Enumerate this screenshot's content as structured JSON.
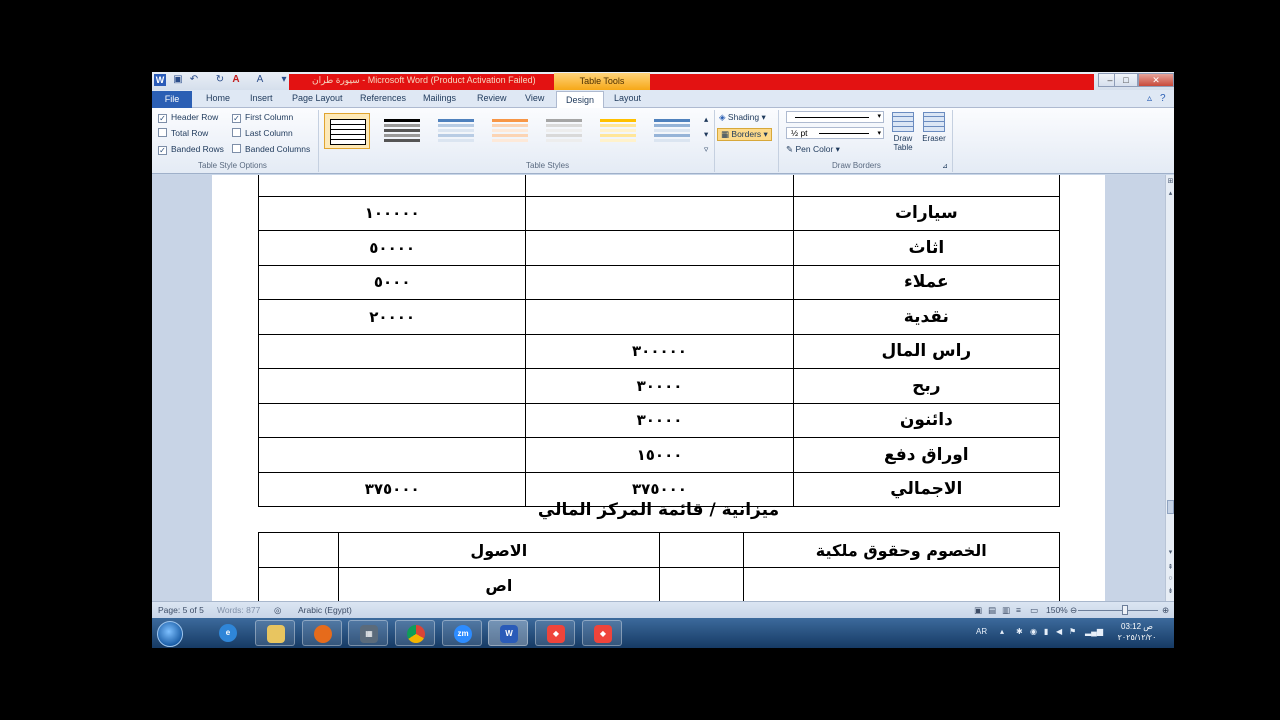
{
  "window": {
    "title": "Microsoft Word (Product Activation Failed)",
    "doc_name": "سيورة طران",
    "contextual_tab": "Table Tools",
    "min_label": "–",
    "max_label": "□",
    "close_label": "✕"
  },
  "tabs": [
    "Home",
    "Insert",
    "Page Layout",
    "References",
    "Mailings",
    "Review",
    "View"
  ],
  "file_tab": "File",
  "design_tab": "Design",
  "layout_tab": "Layout",
  "ribbon": {
    "style_options": {
      "header_row": "Header Row",
      "first_column": "First Column",
      "total_row": "Total Row",
      "last_column": "Last Column",
      "banded_rows": "Banded Rows",
      "banded_columns": "Banded Columns",
      "group_label": "Table Style Options"
    },
    "table_styles_label": "Table Styles",
    "shading": "Shading",
    "borders": "Borders",
    "pen_weight": "½ pt",
    "pen_color": "Pen Color",
    "draw_table": "Draw Table",
    "eraser": "Eraser",
    "draw_borders_label": "Draw Borders"
  },
  "document": {
    "rows": [
      {
        "label": "سيارات",
        "col2": "",
        "col3": "١٠٠٠٠٠"
      },
      {
        "label": "اثاث",
        "col2": "",
        "col3": "٥٠٠٠٠"
      },
      {
        "label": "عملاء",
        "col2": "",
        "col3": "٥٠٠٠"
      },
      {
        "label": "نقدية",
        "col2": "",
        "col3": "٢٠٠٠٠"
      },
      {
        "label": "راس المال",
        "col2": "٣٠٠٠٠٠",
        "col3": ""
      },
      {
        "label": "ربح",
        "col2": "٣٠٠٠٠",
        "col3": ""
      },
      {
        "label": "دائنون",
        "col2": "٣٠٠٠٠",
        "col3": ""
      },
      {
        "label": "اوراق دفع",
        "col2": "١٥٠٠٠",
        "col3": ""
      },
      {
        "label": "الاجمالي",
        "col2": "٣٧٥٠٠٠",
        "col3": "٣٧٥٠٠٠"
      }
    ],
    "caption": "ميزانية / قائمة المركز المالي",
    "balance_header": {
      "liabilities": "الخصوم وحقوق ملكية",
      "assets": "الاصول"
    },
    "balance_row1": {
      "assets": "اص"
    }
  },
  "status": {
    "page": "Page: 5 of 5",
    "words": "Words: 877",
    "language": "Arabic (Egypt)",
    "zoom": "150%"
  },
  "taskbar": {
    "lang": "AR",
    "time": "03:12 ص",
    "date": "٢٠٢٥/١٢/٢٠",
    "apps": [
      "ie-icon",
      "explorer-icon",
      "firefox-icon",
      "calculator-icon",
      "chrome-icon",
      "zoom-icon",
      "word-icon",
      "anydesk-icon",
      "anydesk-icon"
    ]
  }
}
